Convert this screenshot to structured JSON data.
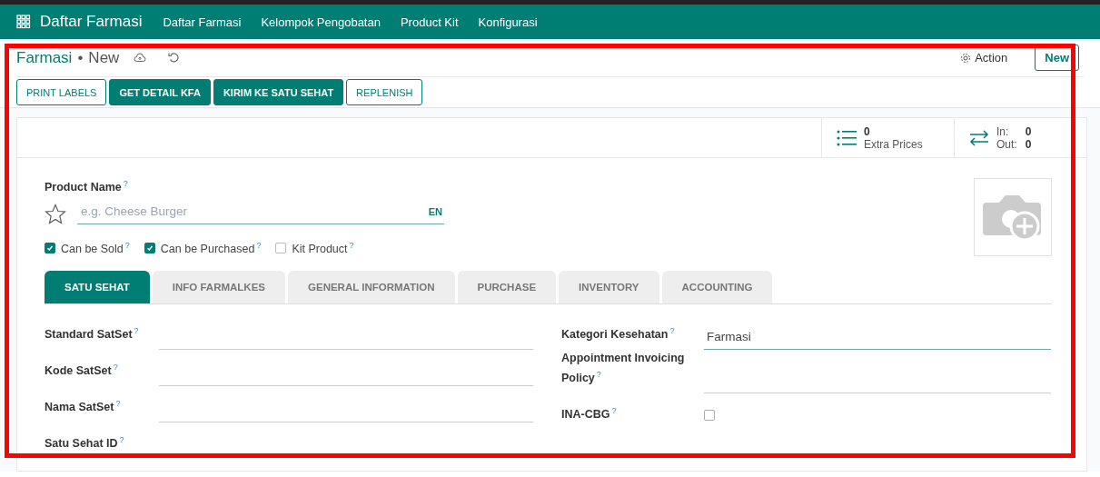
{
  "navbar": {
    "app_name": "Daftar Farmasi",
    "menu": [
      "Daftar Farmasi",
      "Kelompok Pengobatan",
      "Product Kit",
      "Konfigurasi"
    ]
  },
  "breadcrumb": {
    "title": "Farmasi",
    "separator": "•",
    "record": "New"
  },
  "control_actions": {
    "action": "Action",
    "new_button": "New"
  },
  "header_buttons": [
    {
      "label": "PRINT LABELS",
      "primary": false
    },
    {
      "label": "GET DETAIL KFA",
      "primary": true
    },
    {
      "label": "KIRIM KE SATU SEHAT",
      "primary": true
    },
    {
      "label": "REPLENISH",
      "primary": false
    }
  ],
  "stat_buttons": [
    {
      "kind": "list",
      "value": "0",
      "label": "Extra Prices"
    },
    {
      "kind": "transfer",
      "in_label": "In:",
      "in_value": "0",
      "out_label": "Out:",
      "out_value": "0"
    }
  ],
  "product_name": {
    "label": "Product Name",
    "help": "?",
    "placeholder": "e.g. Cheese Burger",
    "language": "EN",
    "favorite": false
  },
  "options": [
    {
      "label": "Can be Sold",
      "help": "?",
      "checked": true
    },
    {
      "label": "Can be Purchased",
      "help": "?",
      "checked": true
    },
    {
      "label": "Kit Product",
      "help": "?",
      "checked": false
    }
  ],
  "tabs": [
    {
      "label": "SATU SEHAT",
      "selected": true
    },
    {
      "label": "INFO FARMALKES",
      "selected": false
    },
    {
      "label": "GENERAL INFORMATION",
      "selected": false
    },
    {
      "label": "PURCHASE",
      "selected": false
    },
    {
      "label": "INVENTORY",
      "selected": false
    },
    {
      "label": "ACCOUNTING",
      "selected": false
    }
  ],
  "left_fields": [
    {
      "kind": "text",
      "label": "Standard SatSet",
      "help": "?"
    },
    {
      "kind": "text",
      "label": "Kode SatSet",
      "help": "?"
    },
    {
      "kind": "text",
      "label": "Nama SatSet",
      "help": "?"
    },
    {
      "kind": "label",
      "label": "Satu Sehat ID",
      "help": "?"
    }
  ],
  "right_fields": [
    {
      "kind": "text",
      "label": "Kategori Kesehatan",
      "help": "?",
      "value": "Farmasi",
      "focused": true
    },
    {
      "kind": "text",
      "label": "Appointment Invoicing Policy",
      "help": "?",
      "focused": false
    },
    {
      "kind": "checkbox",
      "label": "INA-CBG",
      "help": "?",
      "checked": false
    }
  ]
}
